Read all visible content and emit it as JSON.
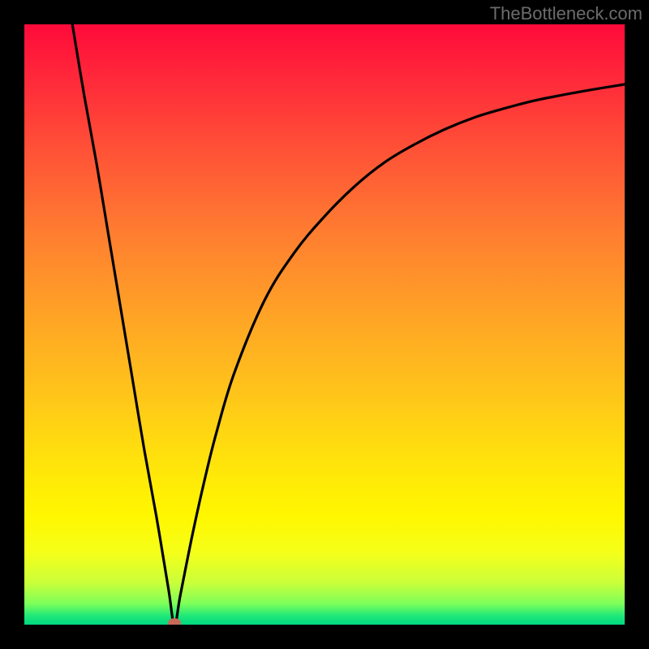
{
  "watermark": "TheBottleneck.com",
  "chart_data": {
    "type": "line",
    "title": "",
    "xlabel": "",
    "ylabel": "",
    "xlim": [
      0,
      100
    ],
    "ylim": [
      0,
      100
    ],
    "optimum_x": 25,
    "marker": {
      "x": 25,
      "y": 0,
      "color": "#c86a5a"
    },
    "series": [
      {
        "name": "bottleneck-curve",
        "x": [
          8,
          10,
          12,
          14,
          16,
          18,
          20,
          22,
          24,
          25,
          26,
          28,
          30,
          32,
          35,
          40,
          45,
          50,
          55,
          60,
          65,
          70,
          75,
          80,
          85,
          90,
          95,
          100
        ],
        "y": [
          100,
          88,
          77,
          65,
          53,
          41,
          29,
          18,
          6,
          0,
          5,
          15,
          24,
          32,
          42,
          54,
          62,
          68,
          73,
          77,
          80,
          82.5,
          84.5,
          86,
          87.3,
          88.3,
          89.2,
          90
        ]
      }
    ],
    "gradient_stops": [
      {
        "offset": 0.0,
        "color": "#ff0a3a"
      },
      {
        "offset": 0.1,
        "color": "#ff2c3a"
      },
      {
        "offset": 0.22,
        "color": "#ff5536"
      },
      {
        "offset": 0.35,
        "color": "#ff7e30"
      },
      {
        "offset": 0.48,
        "color": "#ffa226"
      },
      {
        "offset": 0.62,
        "color": "#ffc61a"
      },
      {
        "offset": 0.74,
        "color": "#ffe60a"
      },
      {
        "offset": 0.82,
        "color": "#fff700"
      },
      {
        "offset": 0.88,
        "color": "#f5ff1a"
      },
      {
        "offset": 0.93,
        "color": "#caff3a"
      },
      {
        "offset": 0.965,
        "color": "#7dff5a"
      },
      {
        "offset": 0.985,
        "color": "#20e878"
      },
      {
        "offset": 1.0,
        "color": "#00d880"
      }
    ]
  }
}
